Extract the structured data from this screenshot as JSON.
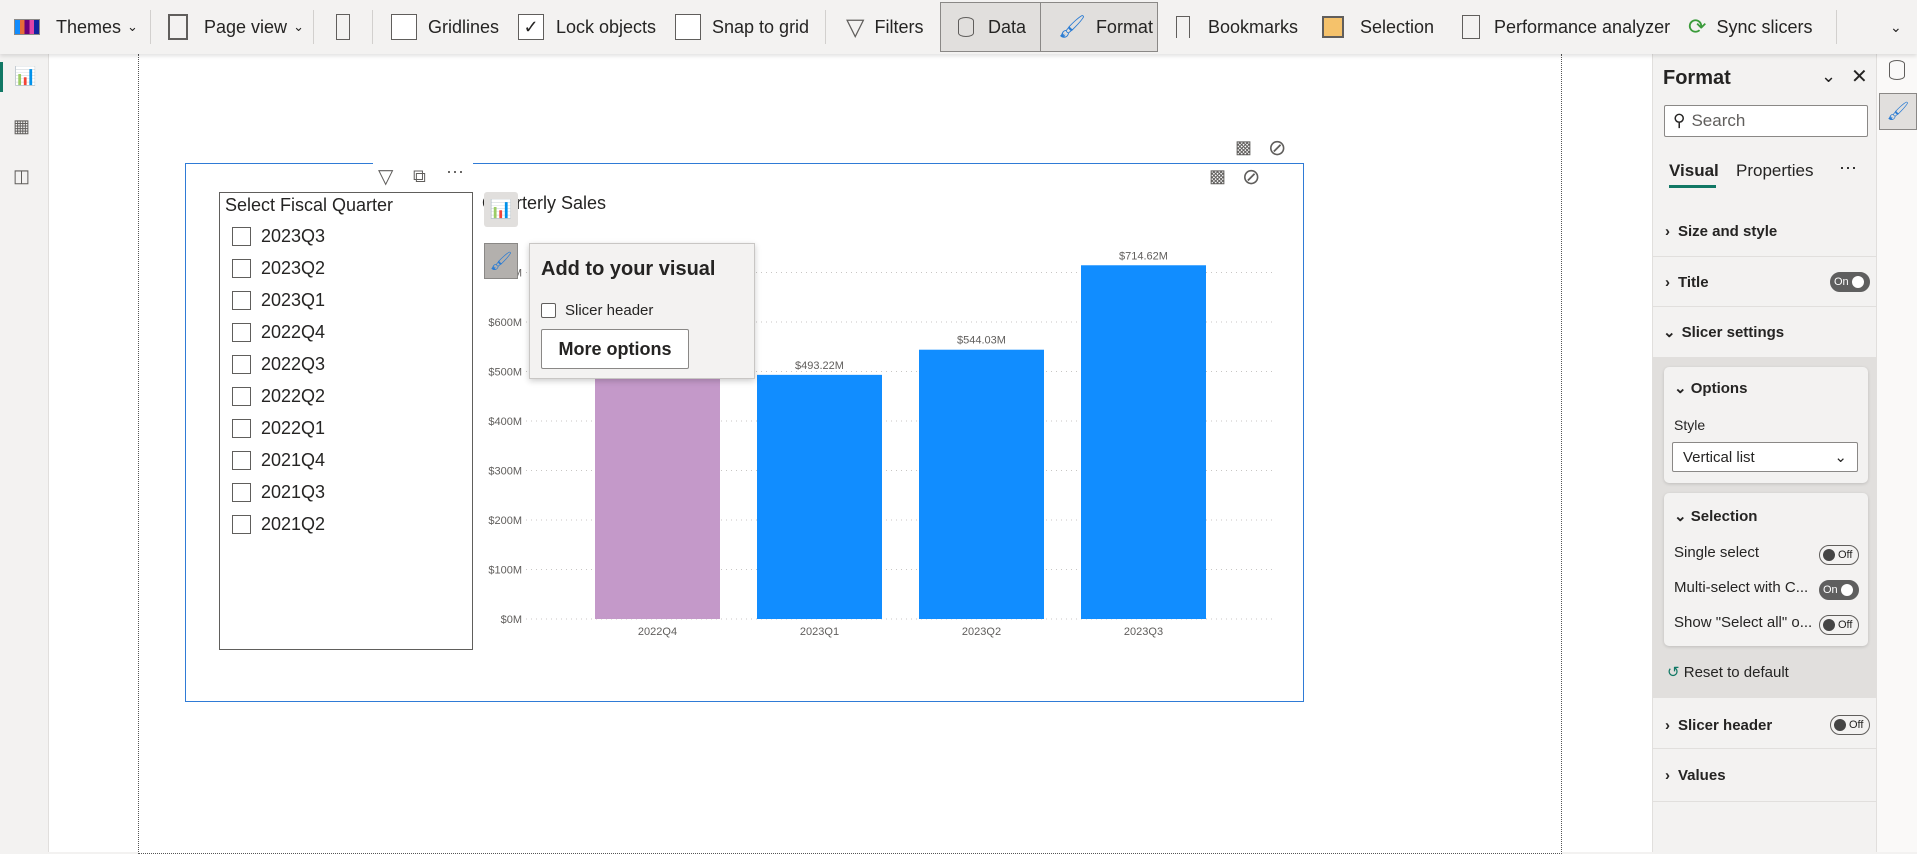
{
  "toolbar": {
    "themes": "Themes",
    "page_view": "Page view",
    "gridlines": {
      "label": "Gridlines",
      "checked": false
    },
    "lock_objects": {
      "label": "Lock objects",
      "checked": true
    },
    "snap_to_grid": {
      "label": "Snap to grid",
      "checked": false
    },
    "filters": "Filters",
    "data": "Data",
    "format": "Format",
    "bookmarks": "Bookmarks",
    "selection": "Selection",
    "performance_analyzer": "Performance analyzer",
    "sync_slicers": "Sync slicers"
  },
  "slicer": {
    "title": "Select Fiscal Quarter",
    "items": [
      "2023Q3",
      "2023Q2",
      "2023Q1",
      "2022Q4",
      "2022Q3",
      "2022Q2",
      "2022Q1",
      "2021Q4",
      "2021Q3",
      "2021Q2"
    ]
  },
  "popup": {
    "title": "Add to your visual",
    "option": "Slicer header",
    "button": "More options"
  },
  "chart_data": {
    "type": "bar",
    "title": "Quarterly Sales",
    "categories": [
      "2022Q4",
      "2023Q1",
      "2023Q2",
      "2023Q3"
    ],
    "values": [
      530,
      493.22,
      544.03,
      714.62
    ],
    "data_labels": [
      "",
      "$493.22M",
      "$544.03M",
      "$714.62M"
    ],
    "colors": [
      "#c499c9",
      "#118dff",
      "#118dff",
      "#118dff"
    ],
    "ylim": [
      0,
      700
    ],
    "yticks": [
      "$0M",
      "$100M",
      "$200M",
      "$300M",
      "$400M",
      "$500M",
      "$600M",
      "$700M"
    ],
    "grid": true,
    "xlabel": "",
    "ylabel": ""
  },
  "format_pane": {
    "title": "Format",
    "search_placeholder": "Search",
    "tabs": [
      "Visual",
      "Properties"
    ],
    "sections": {
      "size_style": "Size and style",
      "title": "Title",
      "title_toggle": "On",
      "slicer_settings": "Slicer settings",
      "options": "Options",
      "style_label": "Style",
      "style_value": "Vertical list",
      "selection": "Selection",
      "single_select": "Single select",
      "single_select_toggle": "Off",
      "multi_select": "Multi-select with C...",
      "multi_select_toggle": "On",
      "show_select_all": "Show \"Select all\" o...",
      "show_select_all_toggle": "Off",
      "reset": "Reset to default",
      "slicer_header": "Slicer header",
      "slicer_header_toggle": "Off",
      "values": "Values"
    }
  },
  "accent": "#117865"
}
